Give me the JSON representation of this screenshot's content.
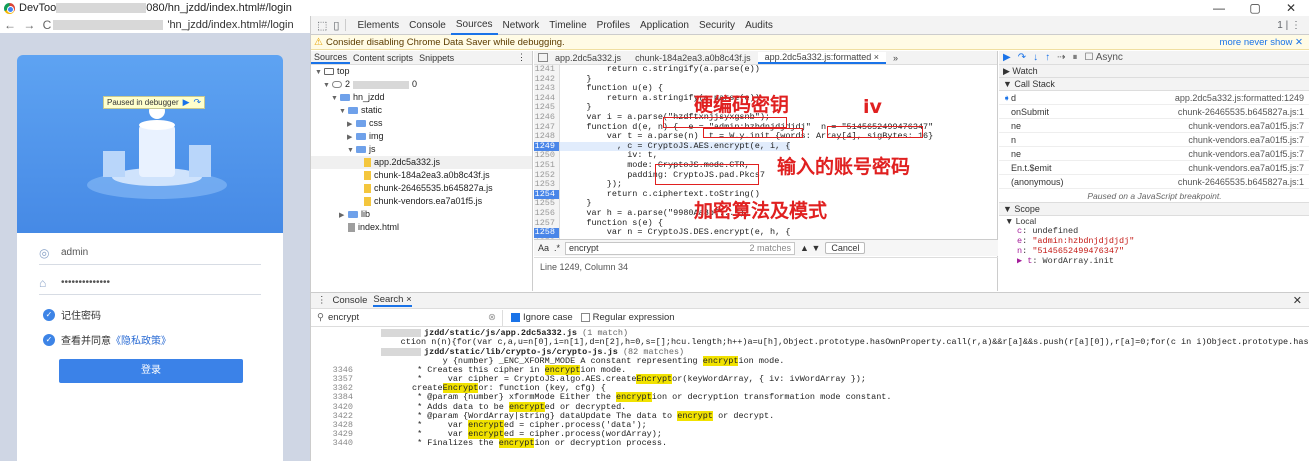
{
  "window": {
    "title_prefix": "DevToo",
    "title_suffix": "080/hn_jzdd/index.html#/login",
    "controls": [
      "—",
      "▢",
      "✕"
    ]
  },
  "address": {
    "nav": "← → C",
    "url": "'hn_jzdd/index.html#/login"
  },
  "login": {
    "debug_banner": "Paused in debugger",
    "debug_buttons": [
      "▶",
      "↷"
    ],
    "username_value": "admin",
    "password_value": "••••••••••••••",
    "remember_label": "记住密码",
    "agree_prefix": "查看并同意",
    "agree_link": "《隐私政策》",
    "login_button": "登录"
  },
  "devtools": {
    "tabs": [
      "Elements",
      "Console",
      "Sources",
      "Network",
      "Timeline",
      "Profiles",
      "Application",
      "Security",
      "Audits"
    ],
    "active_tab": "Sources",
    "right_counter": "1 | ⋮",
    "warning": "Consider disabling Chrome Data Saver while debugging.",
    "warning_links": "more never show ✕",
    "navigator": {
      "tabs": [
        "Sources",
        "Content scripts",
        "Snippets"
      ],
      "more": "⋮",
      "tree": [
        {
          "arrow": "▼",
          "icon": "frame",
          "label": "top"
        },
        {
          "arrow": "▼",
          "icon": "cloud",
          "label": "2",
          "suffix": "0"
        },
        {
          "arrow": "▼",
          "icon": "folder",
          "label": "hn_jzdd"
        },
        {
          "arrow": "▼",
          "icon": "folder",
          "label": "static"
        },
        {
          "arrow": "▶",
          "icon": "folder",
          "label": "css"
        },
        {
          "arrow": "▶",
          "icon": "folder",
          "label": "img"
        },
        {
          "arrow": "▼",
          "icon": "folder",
          "label": "js"
        },
        {
          "arrow": "",
          "icon": "file",
          "label": "app.2dc5a332.js"
        },
        {
          "arrow": "",
          "icon": "file",
          "label": "chunk-184a2ea3.a0b8c43f.js"
        },
        {
          "arrow": "",
          "icon": "file",
          "label": "chunk-26465535.b645827a.js"
        },
        {
          "arrow": "",
          "icon": "file",
          "label": "chunk-vendors.ea7a01f5.js"
        },
        {
          "arrow": "▶",
          "icon": "folder",
          "label": "lib"
        },
        {
          "arrow": "",
          "icon": "file-grey",
          "label": "index.html"
        }
      ]
    },
    "editor": {
      "tabs": [
        "app.2dc5a332.js",
        "chunk-184a2ea3.a0b8c43f.js",
        "app.2dc5a332.js:formatted ×",
        "»"
      ],
      "lines": [
        {
          "n": "1241",
          "code": "        return c.stringify(a.parse(e))"
        },
        {
          "n": "1242",
          "code": "    }"
        },
        {
          "n": "1243",
          "code": "    function u(e) {"
        },
        {
          "n": "1244",
          "code": "        return a.stringify(a.parse(e))"
        },
        {
          "n": "1245",
          "code": "    }"
        },
        {
          "n": "1246",
          "code": "    var i = a.parse(\"hzdftxnjjsyxgsnb\");"
        },
        {
          "n": "1247",
          "code": "    function d(e, n) {  e = \"admin:hzbdnjdjdjdj\"  n = \"5145652499476347\""
        },
        {
          "n": "1248",
          "code": "        var t = a.parse(n)  t = W.y.init {words: Array[4], sigBytes: 16}"
        },
        {
          "n": "1249",
          "code": "          , c = CryptoJS.AES.encrypt(e, i, {"
        },
        {
          "n": "1250",
          "code": "            iv: t,"
        },
        {
          "n": "1251",
          "code": "            mode: CryptoJS.mode.CTR,"
        },
        {
          "n": "1252",
          "code": "            padding: CryptoJS.pad.Pkcs7"
        },
        {
          "n": "1253",
          "code": "        });"
        },
        {
          "n": "1254",
          "code": "        return c.ciphertext.toString()"
        },
        {
          "n": "1255",
          "code": "    }"
        },
        {
          "n": "1256",
          "code": "    var h = a.parse(\"9980Aa8bf...\");"
        },
        {
          "n": "1257",
          "code": "    function s(e) {"
        },
        {
          "n": "1258",
          "code": "        var n = CryptoJS.DES.encrypt(e, h, {"
        },
        {
          "n": "1259",
          "code": ""
        }
      ],
      "find_query": "encrypt",
      "find_count": "2 matches",
      "find_nav": "▲ ▼",
      "find_cancel": "Cancel",
      "find_aa": "Aa",
      "find_regex": ".*",
      "status": "Line 1249, Column 34"
    },
    "debugger": {
      "toolbar": [
        "▶",
        "↷",
        "↓",
        "↑",
        "⇢",
        "⏸"
      ],
      "async_label": "Async",
      "watch": "▶ Watch",
      "callstack": "▼ Call Stack",
      "frames": [
        {
          "fn": "d",
          "loc": "app.2dc5a332.js:formatted:1249",
          "current": true
        },
        {
          "fn": "onSubmit",
          "loc": "chunk-26465535.b645827a.js:1"
        },
        {
          "fn": "ne",
          "loc": "chunk-vendors.ea7a01f5.js:7"
        },
        {
          "fn": "n",
          "loc": "chunk-vendors.ea7a01f5.js:7"
        },
        {
          "fn": "ne",
          "loc": "chunk-vendors.ea7a01f5.js:7"
        },
        {
          "fn": "En.t.$emit",
          "loc": "chunk-vendors.ea7a01f5.js:7"
        },
        {
          "fn": "(anonymous)",
          "loc": "chunk-26465535.b645827a.js:1"
        }
      ],
      "paused_note": "Paused on a JavaScript breakpoint.",
      "scope": "▼ Scope",
      "local": "▼ Local",
      "scope_vars": [
        {
          "k": "c",
          "v": "undefined"
        },
        {
          "k": "e",
          "v": "\"admin:hzbdnjdjdjdj\""
        },
        {
          "k": "n",
          "v": "\"5145652499476347\""
        },
        {
          "k": "▶ t",
          "v": "WordArray.init"
        }
      ]
    },
    "drawer": {
      "tabs": [
        "Console",
        "Search ×"
      ],
      "close": "✕",
      "search_value": "encrypt",
      "ignore_case": "Ignore case",
      "regex": "Regular expression",
      "files": [
        {
          "name": "jzdd/static/js/app.2dc5a332.js",
          "count": "(1 match)"
        },
        {
          "name": "jzdd/static/lib/crypto-js/crypto-js.js",
          "count": "(82 matches)"
        }
      ],
      "results": [
        {
          "n": "",
          "t": "                ction n(n){for(var c,a,u=n[0],i=n[1],d=n[2],h=0,s=[];hcu.length;h++)a=u[h],Object.prototype.hasOwnProperty.call(r,a)&&r[a]&&s.push(r[a][0]),r[a]=0;for(c in i)Object.prototype.hasOwnProperty.call(i,"
        },
        {
          "n": "",
          "t": "                y {number} _ENC_XFORM_MODE A constant representing encryption mode."
        },
        {
          "n": "3346",
          "t": "           * Creates this cipher in encryption mode."
        },
        {
          "n": "3357",
          "t": "           *     var cipher = CryptoJS.algo.AES.createEncryptor(keyWordArray, { iv: ivWordArray });"
        },
        {
          "n": "3362",
          "t": "          createEncryptor: function (key, cfg) {"
        },
        {
          "n": "3384",
          "t": "           * @param {number} xformMode Either the encryption or decryption transformation mode constant."
        },
        {
          "n": "3420",
          "t": "           * Adds data to be encrypted or decrypted."
        },
        {
          "n": "3422",
          "t": "           * @param {WordArray|string} dataUpdate The data to encrypt or decrypt."
        },
        {
          "n": "3428",
          "t": "           *     var encrypted = cipher.process('data');"
        },
        {
          "n": "3429",
          "t": "           *     var encrypted = cipher.process(wordArray);"
        },
        {
          "n": "3440",
          "t": "           * Finalizes the encryption or decryption process."
        }
      ]
    }
  },
  "annotations": {
    "hardcoded_key": "硬编码密钥",
    "iv": "iv",
    "account_password": "输入的账号密码",
    "algorithm_mode": "加密算法及模式"
  },
  "colors": {
    "annotation_red": "#e02020",
    "accent_blue": "#1a73e8",
    "login_blue": "#3b82e8"
  }
}
